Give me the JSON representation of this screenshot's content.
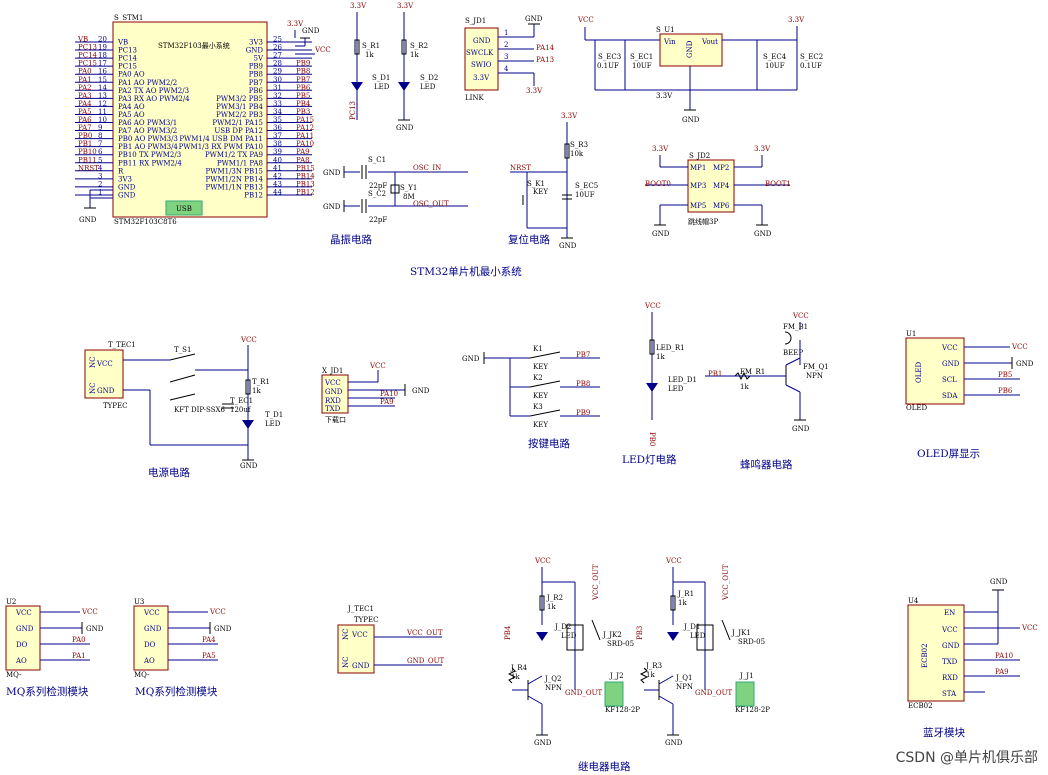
{
  "sections": {
    "mcu": "STM32单片机最小系统",
    "crystal": "晶振电路",
    "reset": "复位电路",
    "power": "电源电路",
    "keys": "按键电路",
    "led": "LED灯电路",
    "buzzer": "蜂鸣器电路",
    "oled": "OLED屏显示",
    "mq1": "MQ系列检测模块",
    "mq2": "MQ系列检测模块",
    "relay": "继电器电路",
    "bt": "蓝牙模块"
  },
  "mcu": {
    "ref": "S_STM1",
    "name": "STM32F103最小系统",
    "part": "STM32F103C8T6",
    "usb": "USB",
    "left_pins": [
      {
        "net": "VB",
        "num": "20",
        "label": "VB"
      },
      {
        "net": "PC13",
        "num": "19",
        "label": "PC13"
      },
      {
        "net": "PC14",
        "num": "18",
        "label": "PC14"
      },
      {
        "net": "PC15",
        "num": "17",
        "label": "PC15"
      },
      {
        "net": "PA0",
        "num": "16",
        "label": "PA0 AO"
      },
      {
        "net": "PA1",
        "num": "15",
        "label": "PA1 AO PWM2/2"
      },
      {
        "net": "PA2",
        "num": "14",
        "label": "PA2 TX AO PWM2/3"
      },
      {
        "net": "PA3",
        "num": "13",
        "label": "PA3 RX AO PWM2/4"
      },
      {
        "net": "PA4",
        "num": "12",
        "label": "PA4 AO"
      },
      {
        "net": "PA5",
        "num": "11",
        "label": "PA5 AO"
      },
      {
        "net": "PA6",
        "num": "10",
        "label": "PA6 AO PWM3/1"
      },
      {
        "net": "PA7",
        "num": "9",
        "label": "PA7 AO PWM3/2"
      },
      {
        "net": "PB0",
        "num": "8",
        "label": "PB0 AO PWM3/3"
      },
      {
        "net": "PB1",
        "num": "7",
        "label": "PB1 AO PWM3/4"
      },
      {
        "net": "PB10",
        "num": "6",
        "label": "PB10 TX PWM2/3"
      },
      {
        "net": "PB11",
        "num": "5",
        "label": "PB11 RX PWM2/4"
      },
      {
        "net": "NRST",
        "num": "4",
        "label": "R"
      },
      {
        "net": "",
        "num": "3",
        "label": "3V3"
      },
      {
        "net": "",
        "num": "2",
        "label": "GND"
      },
      {
        "net": "",
        "num": "1",
        "label": "GND"
      }
    ],
    "right_pins": [
      {
        "net": "",
        "num": "25",
        "label": "3V3"
      },
      {
        "net": "",
        "num": "26",
        "label": "GND"
      },
      {
        "net": "",
        "num": "27",
        "label": "5V"
      },
      {
        "net": "PB9",
        "num": "28",
        "label": "PB9"
      },
      {
        "net": "PB8",
        "num": "29",
        "label": "PB8"
      },
      {
        "net": "PB7",
        "num": "30",
        "label": "PB7"
      },
      {
        "net": "PB6",
        "num": "31",
        "label": "PB6"
      },
      {
        "net": "PB5",
        "num": "32",
        "label": "PWM3/2 PB5"
      },
      {
        "net": "PB4",
        "num": "33",
        "label": "PWM3/1 PB4"
      },
      {
        "net": "PB3",
        "num": "34",
        "label": "PWM2/2 PB3"
      },
      {
        "net": "PA15",
        "num": "35",
        "label": "PWM2/1 PA15"
      },
      {
        "net": "PA12",
        "num": "36",
        "label": "USB DP PA12"
      },
      {
        "net": "PA11",
        "num": "37",
        "label": "PWM1/4 USB DM PA11"
      },
      {
        "net": "PA10",
        "num": "38",
        "label": "PWM1/3 RX PWM PA10"
      },
      {
        "net": "PA9",
        "num": "39",
        "label": "PWM1/2 TX PA9"
      },
      {
        "net": "PA8",
        "num": "40",
        "label": "PWM1/1 PA8"
      },
      {
        "net": "PB15",
        "num": "41",
        "label": "PWM1/3N PB15"
      },
      {
        "net": "PB14",
        "num": "42",
        "label": "PWM1/2N PB14"
      },
      {
        "net": "PB13",
        "num": "43",
        "label": "PWM1/1N PB13"
      },
      {
        "net": "PB12",
        "num": "44",
        "label": "PB12"
      }
    ]
  },
  "labels": {
    "v33": "3.3V",
    "vcc": "VCC",
    "gnd": "GND",
    "sr1": "S_R1",
    "sr2": "S_R2",
    "k1": "1k",
    "sd1": "S_D1",
    "sd2": "S_D2",
    "led": "LED",
    "pc13": "PC13",
    "sjd1": "S_JD1",
    "link": "LINK",
    "pa14": "PA14",
    "pa13": "PA13",
    "j_gnd": "GND",
    "swclk": "SWCLK",
    "swio": "SWIO",
    "j33": "3.3V",
    "su1": "S_U1",
    "vin": "Vin",
    "vout": "Vout",
    "sec3": "S_EC3",
    "sec1": "S_EC1",
    "sec4": "S_EC4",
    "sec2": "S_EC2",
    "c01uf": "0.1UF",
    "c10uf": "10UF",
    "sc1": "S_C1",
    "sc2": "S_C2",
    "c22pf": "22pF",
    "sy1": "S_Y1",
    "y8m": "8M",
    "oscin": "OSC_IN",
    "oscout": "OSC_OUT",
    "sr3": "S_R3",
    "r10k": "10k",
    "nrst": "NRST",
    "sk1": "S_K1",
    "key": "KEY",
    "sec5": "S_EC5",
    "sjd2": "S_JD2",
    "boot0": "BOOT0",
    "boot1": "BOOT1",
    "jump3p": "跳线帽3P",
    "mp1": "MP1",
    "mp2": "MP2",
    "mp3": "MP3",
    "mp4": "MP4",
    "mp5": "MP5",
    "mp6": "MP6",
    "ttec1": "T_TEC1",
    "typec": "TYPEC",
    "ts1": "T_S1",
    "kf": "KFT DIP-SSX6",
    "tec1": "T_EC1",
    "c120": "120uf",
    "tr1": "T_R1",
    "td1": "T_D1",
    "nc": "NC",
    "xjd1": "X_JD1",
    "xzk": "下载口",
    "rxd": "RXD",
    "txd": "TXD",
    "pa10": "PA10",
    "pa9": "PA9",
    "kk1": "K1",
    "kk2": "K2",
    "kk3": "K3",
    "pb7": "PB7",
    "pb8": "PB8",
    "pb9": "PB9",
    "ledr1": "LED_R1",
    "ledd1": "LED_D1",
    "pb0": "PB0",
    "fmb1": "FM_B1",
    "beep": "BEEP",
    "fmr1": "FM_R1",
    "fmq1": "FM_Q1",
    "npn": "NPN",
    "pb1": "PB1",
    "u1": "U1",
    "oled": "OLED",
    "scl": "SCL",
    "sda": "SDA",
    "pb5": "PB5",
    "pb6": "PB6",
    "u2": "U2",
    "u3": "U3",
    "mq": "MQ-",
    "do": "DO",
    "ao": "AO",
    "pa0": "PA0",
    "pa1": "PA1",
    "pa4": "PA4",
    "pa5": "PA5",
    "jtec1": "J_TEC1",
    "vccout": "VCC_OUT",
    "gndout": "GND_OUT",
    "jr2": "J_R2",
    "jd2": "J_D2",
    "jr4": "J_R4",
    "jq2": "J_Q2",
    "jjk2": "J_JK2",
    "srd": "SRD-05",
    "jj2": "J_J2",
    "kf128": "KF128-2P",
    "jr1": "J_R1",
    "jd1": "J_D1",
    "jr3": "J_R3",
    "jq1": "J_Q1",
    "jjk1": "J_JK1",
    "jj1": "J_J1",
    "pb4": "PB4",
    "pb3": "PB3",
    "u4": "U4",
    "en": "EN",
    "sta": "STA",
    "ecb02": "ECB02"
  },
  "watermark": "CSDN @单片机俱乐部"
}
